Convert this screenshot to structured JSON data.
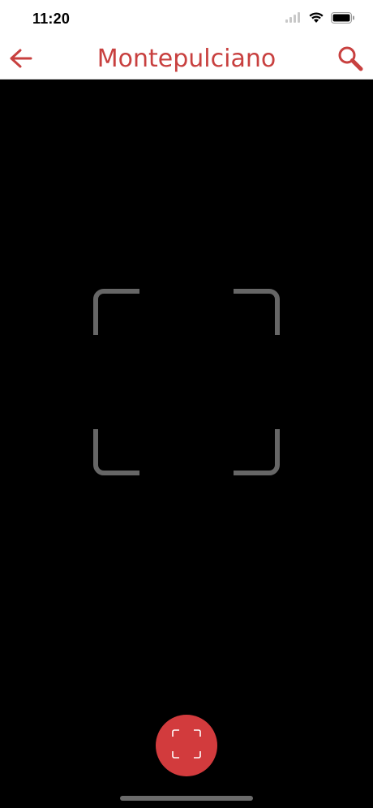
{
  "status_bar": {
    "time": "11:20"
  },
  "nav": {
    "title": "Montepulciano",
    "back_icon": "arrow-left-icon",
    "search_icon": "magnifier-icon"
  },
  "camera": {
    "frame_icon": "scan-frame-corners",
    "capture_icon": "scan-icon"
  },
  "colors": {
    "accent": "#c8403f",
    "capture_button": "#d23b3d",
    "frame_corners": "#666666",
    "background": "#000000"
  }
}
